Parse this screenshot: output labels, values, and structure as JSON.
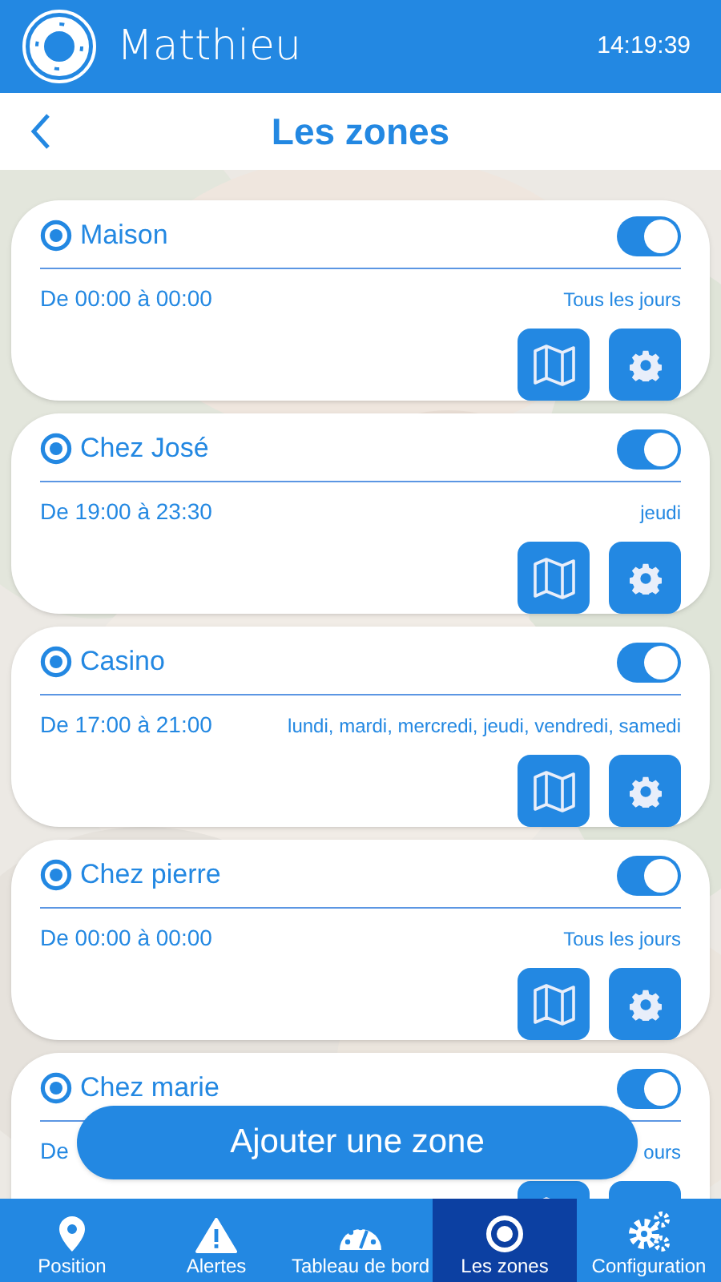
{
  "header": {
    "title": "Matthieu",
    "time": "14:19:39"
  },
  "page_title": "Les zones",
  "zones": [
    {
      "name": "Maison",
      "enabled": true,
      "time": "De 00:00 à 00:00",
      "days": "Tous les jours"
    },
    {
      "name": "Chez José",
      "enabled": true,
      "time": "De 19:00 à 23:30",
      "days": "jeudi"
    },
    {
      "name": "Casino",
      "enabled": true,
      "time": "De 17:00 à 21:00",
      "days": "lundi, mardi, mercredi, jeudi, vendredi, samedi"
    },
    {
      "name": "Chez pierre",
      "enabled": true,
      "time": "De 00:00 à 00:00",
      "days": "Tous les jours"
    },
    {
      "name": "Chez marie",
      "enabled": true,
      "time": "De",
      "days": "ours"
    }
  ],
  "add_button": "Ajouter une zone",
  "nav": [
    {
      "kind": "pin",
      "label": "Position",
      "selected": false
    },
    {
      "kind": "alert",
      "label": "Alertes",
      "selected": false
    },
    {
      "kind": "gauge",
      "label": "Tableau de bord",
      "selected": false
    },
    {
      "kind": "target",
      "label": "Les zones",
      "selected": true
    },
    {
      "kind": "gears",
      "label": "Configuration",
      "selected": false
    }
  ]
}
